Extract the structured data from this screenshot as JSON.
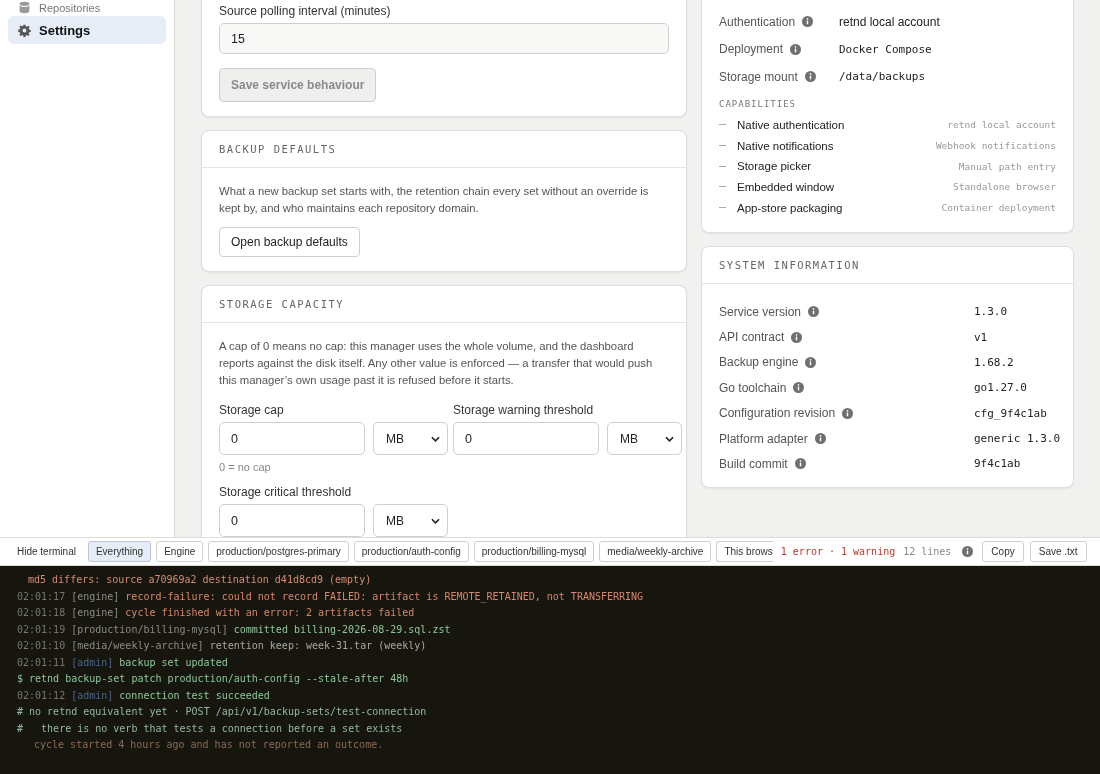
{
  "sidebar": {
    "items": [
      {
        "label": "Repositories",
        "selected": false
      },
      {
        "label": "Settings",
        "selected": true
      }
    ]
  },
  "service_behaviour": {
    "field_label": "Source polling interval (minutes)",
    "value": "15",
    "save_button": {
      "label": "Save service behaviour",
      "disabled": true
    }
  },
  "backup_defaults": {
    "title": "BACKUP DEFAULTS",
    "description": "What a new backup set starts with, the retention chain every set without an override is kept by, and who maintains each repository domain.",
    "button": "Open backup defaults"
  },
  "storage_capacity": {
    "title": "STORAGE CAPACITY",
    "description": "A cap of 0 means no cap: this manager uses the whole volume, and the dashboard reports against the disk itself. Any other value is enforced — a transfer that would push this manager’s own usage past it is refused before it starts.",
    "fields": [
      {
        "label": "Storage cap",
        "value": "0",
        "unit": "MB",
        "hint": "0 = no cap"
      },
      {
        "label": "Storage warning threshold",
        "value": "0",
        "unit": "MB"
      },
      {
        "label": "Storage critical threshold",
        "value": "0",
        "unit": "MB"
      }
    ]
  },
  "platform": {
    "rows": [
      {
        "label": "Authentication",
        "value": "retnd local account",
        "kind": "text"
      },
      {
        "label": "Deployment",
        "value": "Docker Compose",
        "kind": "mono"
      },
      {
        "label": "Storage mount",
        "value": "/data/backups",
        "kind": "mono"
      }
    ],
    "capabilities_title": "CAPABILITIES",
    "capabilities": [
      {
        "name": "Native authentication",
        "fallback": "retnd local account"
      },
      {
        "name": "Native notifications",
        "fallback": "Webhook notifications"
      },
      {
        "name": "Storage picker",
        "fallback": "Manual path entry"
      },
      {
        "name": "Embedded window",
        "fallback": "Standalone browser"
      },
      {
        "name": "App-store packaging",
        "fallback": "Container deployment"
      }
    ]
  },
  "system_information": {
    "title": "SYSTEM INFORMATION",
    "rows": [
      {
        "label": "Service version",
        "value": "1.3.0"
      },
      {
        "label": "API contract",
        "value": "v1"
      },
      {
        "label": "Backup engine",
        "value": "1.68.2"
      },
      {
        "label": "Go toolchain",
        "value": "go1.27.0"
      },
      {
        "label": "Configuration revision",
        "value": "cfg_9f4c1ab"
      },
      {
        "label": "Platform adapter",
        "value": "generic 1.3.0"
      },
      {
        "label": "Build commit",
        "value": "9f4c1ab"
      }
    ]
  },
  "terminal": {
    "hide_label": "Hide terminal",
    "filters": [
      {
        "label": "Everything",
        "selected": true
      },
      {
        "label": "Engine",
        "selected": false
      },
      {
        "label": "production/postgres-primary",
        "selected": false
      },
      {
        "label": "production/auth-config",
        "selected": false
      },
      {
        "label": "production/billing-mysql",
        "selected": false
      },
      {
        "label": "media/weekly-archive",
        "selected": false
      },
      {
        "label": "This brows",
        "selected": false
      }
    ],
    "problems": "1 error · 1 warning",
    "line_count": "12 lines",
    "buttons": [
      "Copy",
      "Save .txt"
    ],
    "lines": [
      {
        "text": "md5 differs: source a70969a2 destination d41d8cd9 (empty)",
        "kind": "detail"
      },
      {
        "time": "02:01:17",
        "source": "[engine]",
        "text": "record-failure: could not record FAILED: artifact is REMOTE_RETAINED, not TRANSFERRING",
        "kind": "error",
        "source_highlight": false
      },
      {
        "time": "02:01:18",
        "source": "[engine]",
        "text": "cycle finished with an error: 2 artifacts failed",
        "kind": "error",
        "source_highlight": false
      },
      {
        "time": "02:01:19",
        "source": "[production/billing-mysql]",
        "text": "committed billing-2026-08-29.sql.zst",
        "kind": "ok",
        "source_highlight": false
      },
      {
        "time": "02:01:10",
        "source": "[media/weekly-archive]",
        "text": "retention keep: week-31.tar (weekly)",
        "kind": "info",
        "source_highlight": false
      },
      {
        "time": "02:01:11",
        "source": "[admin]",
        "text": "backup set updated",
        "kind": "ok",
        "source_highlight": true
      },
      {
        "text": "$ retnd backup-set patch production/auth-config --stale-after 48h",
        "kind": "command"
      },
      {
        "time": "02:01:12",
        "source": "[admin]",
        "text": "connection test succeeded",
        "kind": "ok",
        "source_highlight": true
      },
      {
        "text": "# no retnd equivalent yet · POST /api/v1/backup-sets/test-connection",
        "kind": "comment"
      },
      {
        "text": "#   there is no verb that tests a connection before a set exists",
        "kind": "comment"
      },
      {
        "text": "cycle started 4 hours ago and has not reported an outcome.",
        "kind": "note"
      }
    ]
  }
}
